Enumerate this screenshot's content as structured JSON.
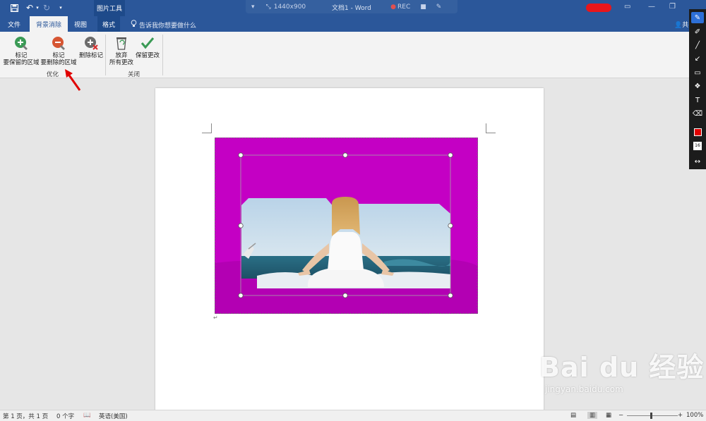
{
  "window": {
    "context_group": "图片工具",
    "doc_title": "文档1 - Word",
    "recorder": {
      "resolution": "1440x900",
      "rec_label": "REC"
    }
  },
  "tabs": [
    {
      "label": "文件",
      "active": false
    },
    {
      "label": "背景消除",
      "active": true
    },
    {
      "label": "视图",
      "active": false
    },
    {
      "label": "格式",
      "active": false
    }
  ],
  "tell_me": "告诉我你想要做什么",
  "share_label": "共",
  "ribbon": {
    "groups": [
      {
        "label": "优化",
        "buttons": [
          {
            "line1": "标记",
            "line2": "要保留的区域",
            "icon": "mark-keep-icon"
          },
          {
            "line1": "标记",
            "line2": "要删除的区域",
            "icon": "mark-remove-icon"
          },
          {
            "line1": "删除标记",
            "line2": "",
            "icon": "delete-mark-icon"
          }
        ]
      },
      {
        "label": "关闭",
        "buttons": [
          {
            "line1": "放弃",
            "line2": "所有更改",
            "icon": "discard-icon"
          },
          {
            "line1": "保留更改",
            "line2": "",
            "icon": "keep-changes-icon"
          }
        ]
      }
    ]
  },
  "status": {
    "page": "第 1 页，共 1 页",
    "words": "0 个字",
    "language": "英语(美国)",
    "zoom": "100%"
  },
  "watermark": {
    "brand": "Bai du 经验",
    "url": "jingyan.baidu.com"
  },
  "colors": {
    "accent": "#2b579a",
    "removal_overlay": "#c400c4",
    "annotation_red": "#e00000"
  },
  "annotation_tools": [
    "pencil-icon",
    "marker-icon",
    "line-icon",
    "arrow-icon",
    "rectangle-icon",
    "blur-icon",
    "text-icon",
    "eraser-icon",
    "color-swatch-icon",
    "size-icon",
    "expand-icon"
  ],
  "annotation_size": "16"
}
